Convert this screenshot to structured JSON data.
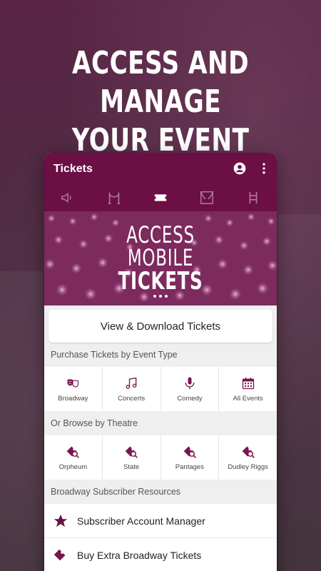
{
  "headline": {
    "line1": "ACCESS AND MANAGE",
    "line2": "YOUR EVENT TICKETS"
  },
  "app": {
    "title": "Tickets",
    "icons": {
      "account": "account-circle-icon",
      "more": "more-vert-icon"
    },
    "colors": {
      "brand": "#6b0f45",
      "accent": "#7a1550"
    }
  },
  "tabs": [
    {
      "icon": "megaphone-icon",
      "active": false
    },
    {
      "icon": "stanchion-icon",
      "active": false
    },
    {
      "icon": "ticket-icon",
      "active": true
    },
    {
      "icon": "theater-curtain-icon",
      "active": false
    },
    {
      "icon": "seats-icon",
      "active": false
    }
  ],
  "banner": {
    "line1": "ACCESS",
    "line2": "MOBILE",
    "line3": "TICKETS",
    "pages": 3
  },
  "view_button": {
    "label": "View & Download Tickets"
  },
  "event_types": {
    "heading": "Purchase Tickets by Event Type",
    "items": [
      {
        "label": "Broadway",
        "icon": "theater-masks-icon"
      },
      {
        "label": "Concerts",
        "icon": "music-note-icon"
      },
      {
        "label": "Comedy",
        "icon": "microphone-icon"
      },
      {
        "label": "All Events",
        "icon": "calendar-icon"
      }
    ]
  },
  "theatres": {
    "heading": "Or Browse by Theatre",
    "items": [
      {
        "label": "Orpheum",
        "icon": "theatre-search-icon"
      },
      {
        "label": "State",
        "icon": "theatre-search-icon"
      },
      {
        "label": "Pantages",
        "icon": "theatre-search-icon"
      },
      {
        "label": "Dudley Riggs",
        "icon": "theatre-search-icon"
      }
    ]
  },
  "resources": {
    "heading": "Broadway Subscriber Resources",
    "items": [
      {
        "label": "Subscriber Account Manager",
        "icon": "star-icon"
      },
      {
        "label": "Buy Extra Broadway Tickets",
        "icon": "ticket-icon"
      }
    ]
  }
}
